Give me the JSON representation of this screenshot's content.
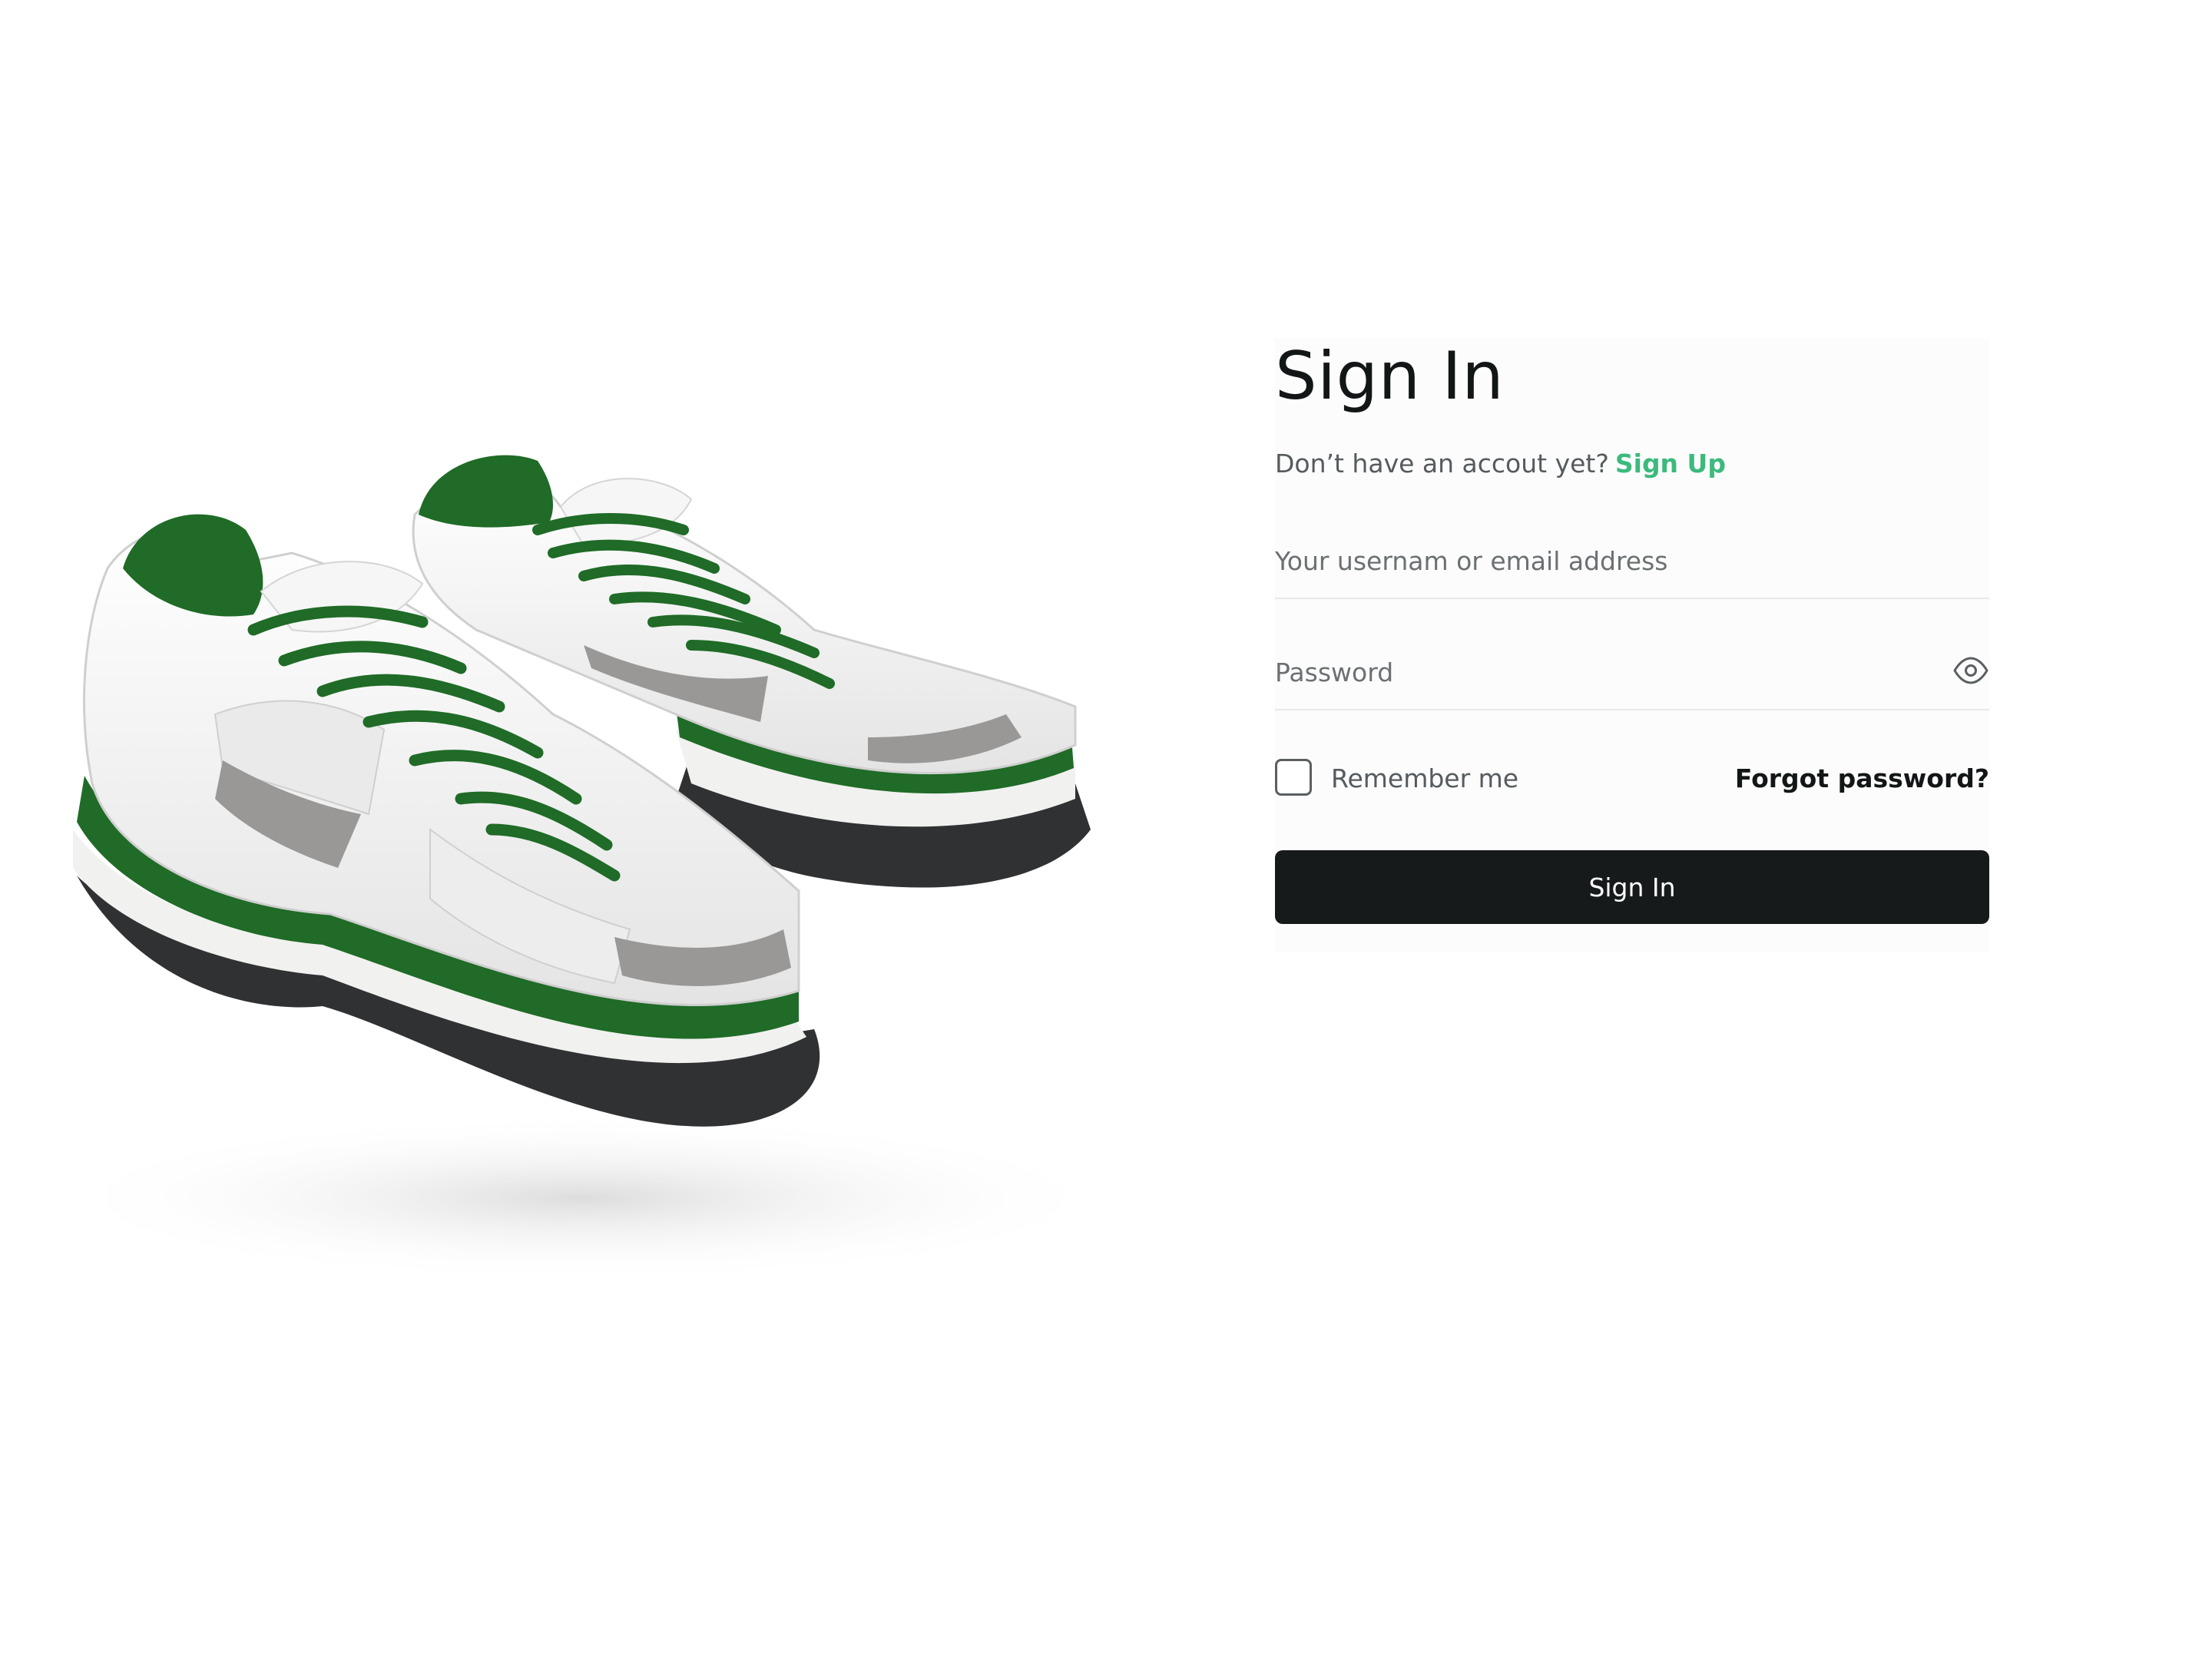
{
  "hero": {
    "image_label": "sneakers-image",
    "colors": {
      "accent_green": "#1f6b27",
      "sole_dark": "#2f3133",
      "upper": "#f3f3f3",
      "trim_grey": "#9a9896"
    }
  },
  "signin": {
    "title": "Sign In",
    "prompt": "Don’t have an accout yet?",
    "signup_link": "Sign Up",
    "username_placeholder": "Your usernam or email address",
    "password_placeholder": "Password",
    "remember_label": "Remember me",
    "forgot_link": "Forgot password?",
    "submit_label": "Sign In",
    "remember_checked": false
  },
  "icons": {
    "password_toggle": "eye-icon"
  },
  "theme": {
    "accent": "#3bba7c",
    "button_bg": "#161a1b",
    "text": "#121617",
    "muted_text": "#555b5e"
  }
}
